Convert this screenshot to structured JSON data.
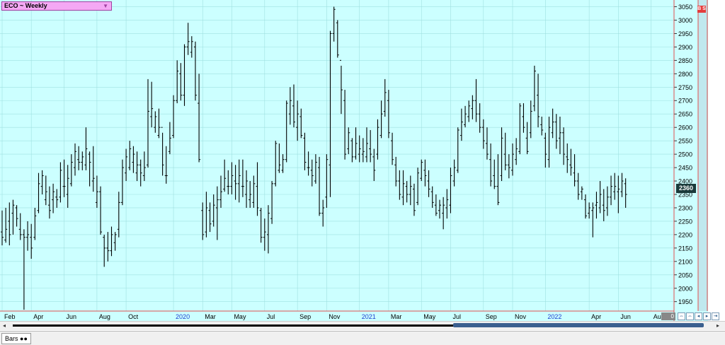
{
  "header": {
    "title": "ECO ~ Weekly"
  },
  "price_tag": "2360",
  "right_tag": "B S",
  "bottom_tab": "Bars",
  "gray_box": "0",
  "colors": {
    "plot_bg": "#ccffff",
    "grid": "#9fe0e0",
    "axis_red": "#e05050",
    "bar": "#000000",
    "year_label": "#2040d0"
  },
  "chart_data": {
    "type": "ohlc",
    "title": "ECO ~ Weekly",
    "y_ticks": [
      1950,
      2000,
      2050,
      2100,
      2150,
      2200,
      2250,
      2300,
      2350,
      2400,
      2450,
      2500,
      2550,
      2600,
      2650,
      2700,
      2750,
      2800,
      2850,
      2900,
      2950,
      3000,
      3050
    ],
    "ylim": [
      1915,
      3075
    ],
    "x_labels": [
      {
        "label": "Feb",
        "week": 0,
        "year": false
      },
      {
        "label": "Apr",
        "week": 8,
        "year": false
      },
      {
        "label": "Jun",
        "week": 17,
        "year": false
      },
      {
        "label": "Aug",
        "week": 26,
        "year": false
      },
      {
        "label": "Oct",
        "week": 34,
        "year": false
      },
      {
        "label": "2020",
        "week": 47,
        "year": true
      },
      {
        "label": "Mar",
        "week": 55,
        "year": false
      },
      {
        "label": "May",
        "week": 63,
        "year": false
      },
      {
        "label": "Jul",
        "week": 72,
        "year": false
      },
      {
        "label": "Sep",
        "week": 81,
        "year": false
      },
      {
        "label": "Nov",
        "week": 89,
        "year": false
      },
      {
        "label": "2021",
        "week": 98,
        "year": true
      },
      {
        "label": "Mar",
        "week": 106,
        "year": false
      },
      {
        "label": "May",
        "week": 115,
        "year": false
      },
      {
        "label": "Jul",
        "week": 123,
        "year": false
      },
      {
        "label": "Sep",
        "week": 132,
        "year": false
      },
      {
        "label": "Nov",
        "week": 140,
        "year": false
      },
      {
        "label": "2022",
        "week": 149,
        "year": true
      },
      {
        "label": "Apr",
        "week": 161,
        "year": false
      },
      {
        "label": "Jun",
        "week": 169,
        "year": false
      },
      {
        "label": "Aug",
        "week": 178,
        "year": false
      }
    ],
    "bars": [
      [
        2290,
        2160,
        2210,
        2190
      ],
      [
        2300,
        2170,
        2180,
        2220
      ],
      [
        2320,
        2160,
        2250,
        2200
      ],
      [
        2330,
        2200,
        2280,
        2310
      ],
      [
        2310,
        2230,
        2300,
        2260
      ],
      [
        2280,
        2180,
        2220,
        2200
      ],
      [
        2220,
        1920,
        2200,
        2190
      ],
      [
        2250,
        2140,
        2190,
        2200
      ],
      [
        2240,
        2110,
        2190,
        2150
      ],
      [
        2300,
        2180,
        2190,
        2270
      ],
      [
        2430,
        2280,
        2290,
        2390
      ],
      [
        2440,
        2350,
        2380,
        2420
      ],
      [
        2420,
        2310,
        2330,
        2360
      ],
      [
        2380,
        2260,
        2310,
        2290
      ],
      [
        2390,
        2280,
        2330,
        2360
      ],
      [
        2370,
        2300,
        2340,
        2330
      ],
      [
        2470,
        2320,
        2340,
        2440
      ],
      [
        2480,
        2340,
        2380,
        2380
      ],
      [
        2460,
        2300,
        2350,
        2410
      ],
      [
        2500,
        2380,
        2390,
        2470
      ],
      [
        2540,
        2420,
        2450,
        2510
      ],
      [
        2530,
        2440,
        2480,
        2470
      ],
      [
        2510,
        2440,
        2470,
        2490
      ],
      [
        2600,
        2440,
        2460,
        2520
      ],
      [
        2510,
        2380,
        2500,
        2470
      ],
      [
        2530,
        2360,
        2400,
        2410
      ],
      [
        2420,
        2300,
        2320,
        2360
      ],
      [
        2380,
        2200,
        2360,
        2210
      ],
      [
        2200,
        2080,
        2190,
        2150
      ],
      [
        2210,
        2100,
        2150,
        2140
      ],
      [
        2230,
        2120,
        2140,
        2200
      ],
      [
        2210,
        2140,
        2170,
        2200
      ],
      [
        2360,
        2190,
        2220,
        2320
      ],
      [
        2480,
        2310,
        2320,
        2450
      ],
      [
        2520,
        2400,
        2430,
        2490
      ],
      [
        2550,
        2440,
        2450,
        2520
      ],
      [
        2530,
        2430,
        2470,
        2500
      ],
      [
        2510,
        2400,
        2430,
        2460
      ],
      [
        2480,
        2380,
        2460,
        2430
      ],
      [
        2510,
        2400,
        2420,
        2450
      ],
      [
        2780,
        2450,
        2460,
        2660
      ],
      [
        2770,
        2600,
        2640,
        2670
      ],
      [
        2660,
        2580,
        2600,
        2640
      ],
      [
        2670,
        2560,
        2570,
        2600
      ],
      [
        2580,
        2420,
        2600,
        2460
      ],
      [
        2530,
        2390,
        2420,
        2420
      ],
      [
        2620,
        2500,
        2510,
        2560
      ],
      [
        2720,
        2560,
        2570,
        2700
      ],
      [
        2850,
        2690,
        2700,
        2810
      ],
      [
        2840,
        2700,
        2800,
        2720
      ],
      [
        2910,
        2680,
        2720,
        2900
      ],
      [
        2990,
        2870,
        2900,
        2920
      ],
      [
        2940,
        2860,
        2880,
        2920
      ],
      [
        2920,
        2700,
        2900,
        2720
      ],
      [
        2800,
        2470,
        2690,
        2480
      ],
      [
        2320,
        2180,
        2290,
        2200
      ],
      [
        2360,
        2190,
        2210,
        2300
      ],
      [
        2320,
        2210,
        2290,
        2240
      ],
      [
        2350,
        2230,
        2250,
        2310
      ],
      [
        2380,
        2180,
        2300,
        2330
      ],
      [
        2420,
        2300,
        2330,
        2360
      ],
      [
        2480,
        2360,
        2370,
        2410
      ],
      [
        2440,
        2350,
        2380,
        2380
      ],
      [
        2470,
        2350,
        2380,
        2420
      ],
      [
        2460,
        2330,
        2400,
        2390
      ],
      [
        2480,
        2320,
        2390,
        2420
      ],
      [
        2480,
        2340,
        2380,
        2380
      ],
      [
        2440,
        2300,
        2350,
        2400
      ],
      [
        2400,
        2300,
        2330,
        2350
      ],
      [
        2420,
        2300,
        2320,
        2390
      ],
      [
        2470,
        2270,
        2380,
        2300
      ],
      [
        2300,
        2170,
        2290,
        2190
      ],
      [
        2260,
        2140,
        2190,
        2210
      ],
      [
        2310,
        2130,
        2200,
        2280
      ],
      [
        2400,
        2240,
        2260,
        2390
      ],
      [
        2550,
        2380,
        2390,
        2540
      ],
      [
        2540,
        2430,
        2440,
        2460
      ],
      [
        2500,
        2430,
        2440,
        2480
      ],
      [
        2700,
        2470,
        2480,
        2690
      ],
      [
        2750,
        2610,
        2650,
        2700
      ],
      [
        2760,
        2600,
        2680,
        2620
      ],
      [
        2700,
        2550,
        2600,
        2650
      ],
      [
        2670,
        2560,
        2640,
        2570
      ],
      [
        2580,
        2440,
        2560,
        2470
      ],
      [
        2510,
        2420,
        2450,
        2450
      ],
      [
        2480,
        2380,
        2440,
        2420
      ],
      [
        2500,
        2390,
        2400,
        2470
      ],
      [
        2490,
        2270,
        2450,
        2280
      ],
      [
        2330,
        2230,
        2280,
        2300
      ],
      [
        2500,
        2300,
        2340,
        2480
      ],
      [
        2960,
        2340,
        2460,
        2950
      ],
      [
        3050,
        2920,
        2950,
        3040
      ],
      [
        3000,
        2860,
        2990,
        2870
      ],
      [
        2830,
        2650,
        2850,
        2740
      ],
      [
        2740,
        2480,
        2700,
        2500
      ],
      [
        2600,
        2500,
        2520,
        2580
      ],
      [
        2560,
        2470,
        2550,
        2490
      ],
      [
        2600,
        2480,
        2490,
        2540
      ],
      [
        2570,
        2470,
        2500,
        2520
      ],
      [
        2560,
        2470,
        2500,
        2510
      ],
      [
        2600,
        2470,
        2490,
        2540
      ],
      [
        2590,
        2470,
        2520,
        2500
      ],
      [
        2520,
        2400,
        2490,
        2440
      ],
      [
        2630,
        2480,
        2500,
        2600
      ],
      [
        2700,
        2560,
        2570,
        2650
      ],
      [
        2780,
        2640,
        2660,
        2730
      ],
      [
        2740,
        2560,
        2700,
        2580
      ],
      [
        2580,
        2460,
        2550,
        2480
      ],
      [
        2490,
        2380,
        2460,
        2400
      ],
      [
        2440,
        2330,
        2400,
        2350
      ],
      [
        2440,
        2310,
        2340,
        2390
      ],
      [
        2400,
        2320,
        2380,
        2350
      ],
      [
        2420,
        2310,
        2350,
        2380
      ],
      [
        2390,
        2270,
        2370,
        2290
      ],
      [
        2450,
        2310,
        2320,
        2430
      ],
      [
        2480,
        2400,
        2410,
        2470
      ],
      [
        2480,
        2380,
        2440,
        2420
      ],
      [
        2440,
        2340,
        2400,
        2370
      ],
      [
        2380,
        2300,
        2360,
        2320
      ],
      [
        2350,
        2270,
        2310,
        2280
      ],
      [
        2330,
        2260,
        2290,
        2310
      ],
      [
        2340,
        2220,
        2280,
        2310
      ],
      [
        2370,
        2260,
        2300,
        2330
      ],
      [
        2450,
        2280,
        2310,
        2420
      ],
      [
        2480,
        2380,
        2400,
        2450
      ],
      [
        2600,
        2430,
        2440,
        2590
      ],
      [
        2670,
        2550,
        2570,
        2620
      ],
      [
        2680,
        2600,
        2610,
        2650
      ],
      [
        2700,
        2620,
        2640,
        2680
      ],
      [
        2720,
        2630,
        2670,
        2700
      ],
      [
        2780,
        2620,
        2700,
        2650
      ],
      [
        2690,
        2580,
        2650,
        2600
      ],
      [
        2630,
        2520,
        2600,
        2550
      ],
      [
        2600,
        2480,
        2540,
        2500
      ],
      [
        2540,
        2380,
        2480,
        2400
      ],
      [
        2480,
        2370,
        2420,
        2380
      ],
      [
        2500,
        2310,
        2380,
        2320
      ],
      [
        2600,
        2400,
        2420,
        2560
      ],
      [
        2580,
        2440,
        2500,
        2460
      ],
      [
        2500,
        2410,
        2460,
        2450
      ],
      [
        2540,
        2420,
        2440,
        2500
      ],
      [
        2560,
        2460,
        2480,
        2520
      ],
      [
        2690,
        2500,
        2510,
        2680
      ],
      [
        2690,
        2580,
        2640,
        2600
      ],
      [
        2620,
        2500,
        2560,
        2510
      ],
      [
        2700,
        2560,
        2580,
        2660
      ],
      [
        2830,
        2660,
        2680,
        2810
      ],
      [
        2800,
        2600,
        2720,
        2640
      ],
      [
        2640,
        2570,
        2610,
        2590
      ],
      [
        2580,
        2450,
        2560,
        2500
      ],
      [
        2640,
        2450,
        2480,
        2600
      ],
      [
        2670,
        2560,
        2580,
        2620
      ],
      [
        2650,
        2520,
        2620,
        2550
      ],
      [
        2640,
        2500,
        2560,
        2580
      ],
      [
        2600,
        2460,
        2580,
        2500
      ],
      [
        2540,
        2430,
        2490,
        2480
      ],
      [
        2520,
        2420,
        2460,
        2450
      ],
      [
        2500,
        2380,
        2430,
        2400
      ],
      [
        2430,
        2330,
        2400,
        2350
      ],
      [
        2380,
        2330,
        2360,
        2370
      ],
      [
        2350,
        2260,
        2330,
        2270
      ],
      [
        2320,
        2260,
        2280,
        2300
      ],
      [
        2320,
        2190,
        2290,
        2300
      ],
      [
        2360,
        2260,
        2310,
        2320
      ],
      [
        2400,
        2280,
        2300,
        2350
      ],
      [
        2370,
        2250,
        2310,
        2290
      ],
      [
        2380,
        2270,
        2300,
        2340
      ],
      [
        2420,
        2310,
        2340,
        2380
      ],
      [
        2430,
        2330,
        2360,
        2380
      ],
      [
        2420,
        2280,
        2360,
        2370
      ],
      [
        2430,
        2340,
        2360,
        2400
      ],
      [
        2410,
        2300,
        2390,
        2350
      ]
    ]
  }
}
